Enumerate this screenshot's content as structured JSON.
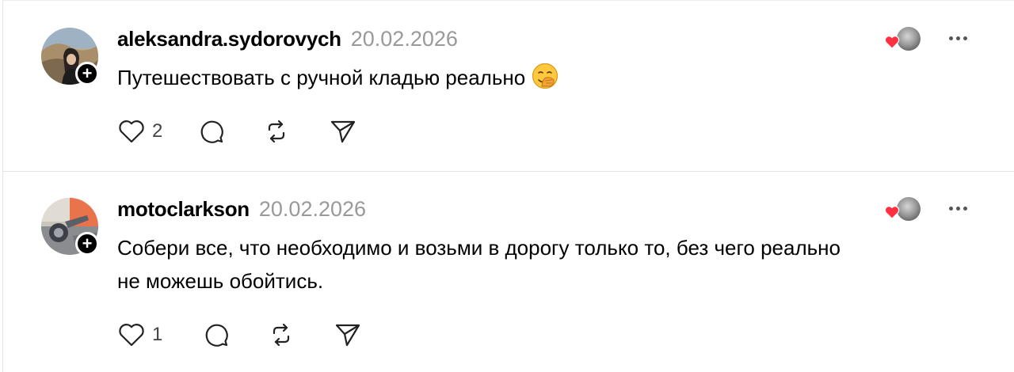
{
  "posts": [
    {
      "username": "aleksandra.sydorovych",
      "timestamp": "20.02.2026",
      "text": "Путешествовать с ручной кладью реально",
      "emoji": "face-with-hand-over-mouth",
      "likes": "2",
      "follow_symbol": "+"
    },
    {
      "username": "motoclarkson",
      "timestamp": "20.02.2026",
      "text_line1": "Собери все, что необходимо и возьми в дорогу только то, без чего реально",
      "text_line2": "не можешь обойтись.",
      "likes": "1",
      "follow_symbol": "+"
    }
  ],
  "colors": {
    "heart": "#ff3040",
    "timestamp": "#999999",
    "divider": "#e3e3e3"
  },
  "icons": [
    "heart-icon",
    "comment-icon",
    "repost-icon",
    "share-icon",
    "more-icon",
    "plus-icon"
  ]
}
